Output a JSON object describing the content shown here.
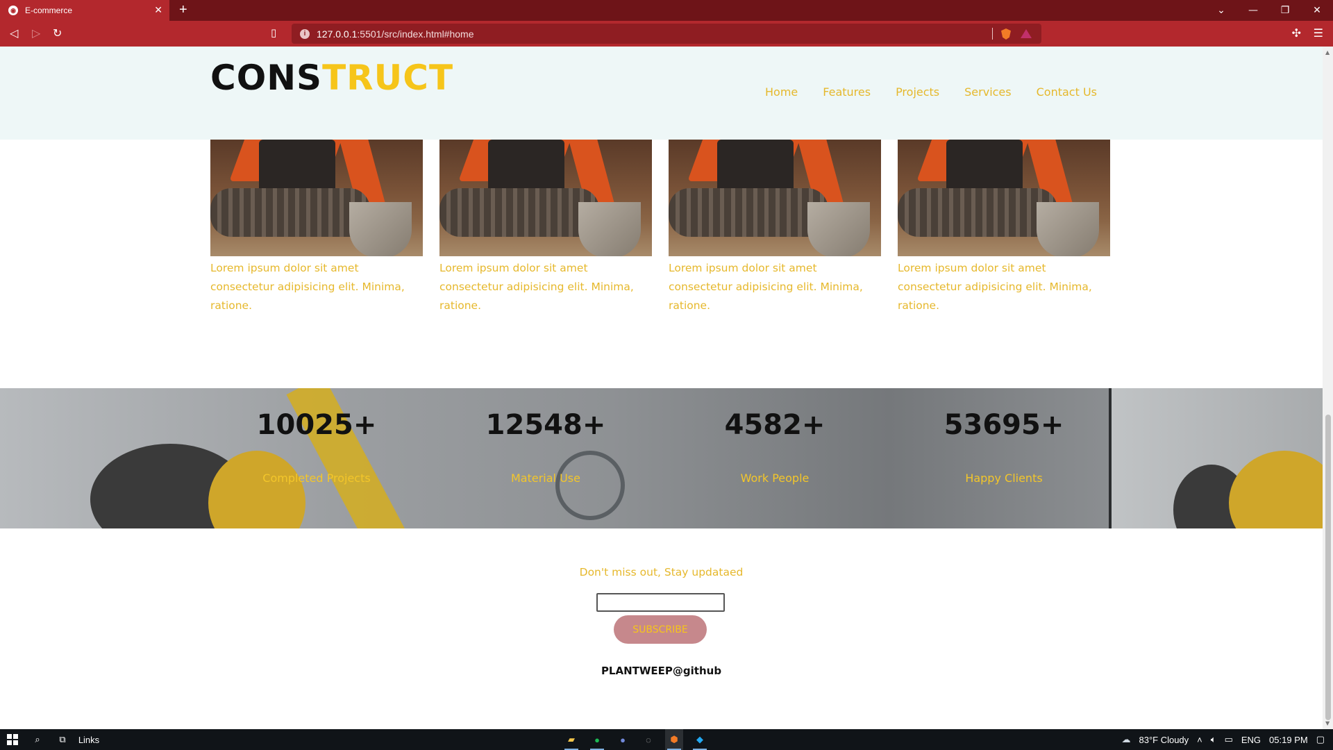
{
  "browser": {
    "tab_title": "E-commerce",
    "tab_close": "✕",
    "new_tab": "+",
    "url_host": "127.0.0.1",
    "url_rest": ":5501/src/index.html#home",
    "window_controls": [
      "⌄",
      "—",
      "❐",
      "✕"
    ]
  },
  "site": {
    "logo_part1": "CONS",
    "logo_part2": "TRUCT",
    "nav": [
      "Home",
      "Features",
      "Projects",
      "Services",
      "Contact Us"
    ]
  },
  "projects": [
    {
      "text": "Lorem ipsum dolor sit amet consectetur adipisicing elit. Minima, ratione."
    },
    {
      "text": "Lorem ipsum dolor sit amet consectetur adipisicing elit. Minima, ratione."
    },
    {
      "text": "Lorem ipsum dolor sit amet consectetur adipisicing elit. Minima, ratione."
    },
    {
      "text": "Lorem ipsum dolor sit amet consectetur adipisicing elit. Minima, ratione."
    }
  ],
  "stats": [
    {
      "number": "10025+",
      "label": "Completed Projects"
    },
    {
      "number": "12548+",
      "label": "Material Use"
    },
    {
      "number": "4582+",
      "label": "Work People"
    },
    {
      "number": "53695+",
      "label": "Happy Clients"
    }
  ],
  "subscribe": {
    "title": "Don't miss out, Stay updataed",
    "input_value": "",
    "button": "SUBSCRIBE"
  },
  "footer": {
    "credit": "PLANTWEEP@github"
  },
  "taskbar": {
    "links_label": "Links",
    "weather": "83°F  Cloudy",
    "language": "ENG",
    "time": "05:19 PM"
  },
  "colors": {
    "accent": "#f6c51a",
    "browser_chrome": "#b3282d",
    "header_bg": "#eef7f7"
  }
}
